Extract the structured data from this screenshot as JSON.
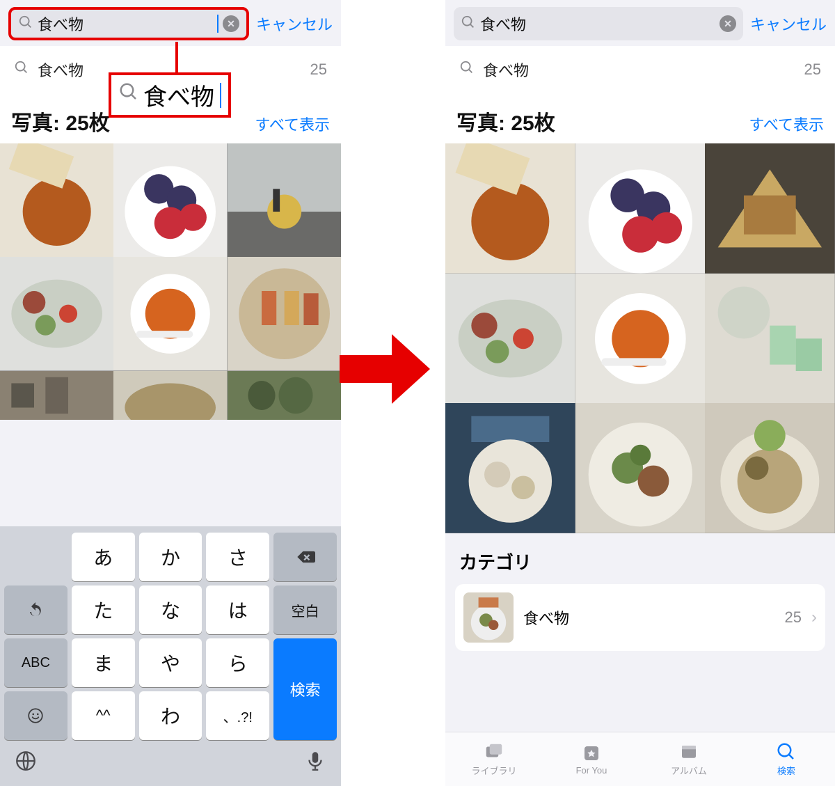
{
  "colors": {
    "accent": "#0a7bff",
    "highlight": "#e60000"
  },
  "search": {
    "query": "食べ物",
    "cancel": "キャンセル",
    "suggestion": "食べ物",
    "suggestion_count": "25",
    "callout_text": "食べ物"
  },
  "results": {
    "title": "写真: 25枚",
    "show_all": "すべて表示"
  },
  "keyboard": {
    "rows": [
      [
        "",
        "あ",
        "か",
        "さ",
        "⌫"
      ],
      [
        "↺",
        "た",
        "な",
        "は",
        "空白"
      ],
      [
        "ABC",
        "ま",
        "や",
        "ら",
        "検索"
      ],
      [
        "☺",
        "^^",
        "わ",
        "、.?!",
        ""
      ]
    ]
  },
  "category": {
    "heading": "カテゴリ",
    "label": "食べ物",
    "count": "25"
  },
  "tabs": {
    "library": "ライブラリ",
    "foryou": "For You",
    "album": "アルバム",
    "search": "検索"
  }
}
